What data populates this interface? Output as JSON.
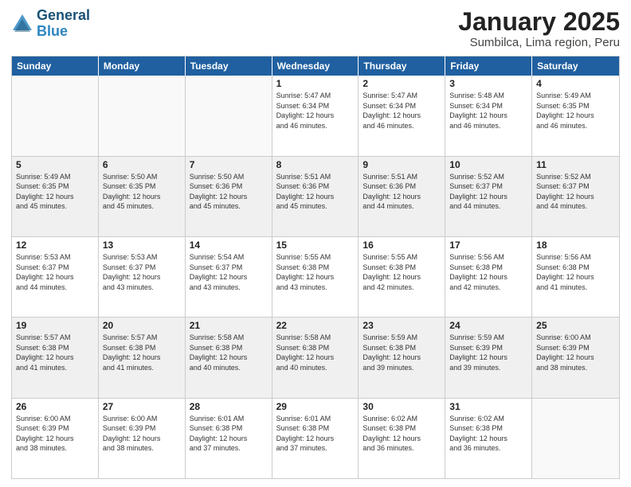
{
  "logo": {
    "text1": "General",
    "text2": "Blue"
  },
  "title": "January 2025",
  "subtitle": "Sumbilca, Lima region, Peru",
  "days": [
    "Sunday",
    "Monday",
    "Tuesday",
    "Wednesday",
    "Thursday",
    "Friday",
    "Saturday"
  ],
  "rows": [
    [
      {
        "day": "",
        "info": ""
      },
      {
        "day": "",
        "info": ""
      },
      {
        "day": "",
        "info": ""
      },
      {
        "day": "1",
        "info": "Sunrise: 5:47 AM\nSunset: 6:34 PM\nDaylight: 12 hours\nand 46 minutes."
      },
      {
        "day": "2",
        "info": "Sunrise: 5:47 AM\nSunset: 6:34 PM\nDaylight: 12 hours\nand 46 minutes."
      },
      {
        "day": "3",
        "info": "Sunrise: 5:48 AM\nSunset: 6:34 PM\nDaylight: 12 hours\nand 46 minutes."
      },
      {
        "day": "4",
        "info": "Sunrise: 5:49 AM\nSunset: 6:35 PM\nDaylight: 12 hours\nand 46 minutes."
      }
    ],
    [
      {
        "day": "5",
        "info": "Sunrise: 5:49 AM\nSunset: 6:35 PM\nDaylight: 12 hours\nand 45 minutes."
      },
      {
        "day": "6",
        "info": "Sunrise: 5:50 AM\nSunset: 6:35 PM\nDaylight: 12 hours\nand 45 minutes."
      },
      {
        "day": "7",
        "info": "Sunrise: 5:50 AM\nSunset: 6:36 PM\nDaylight: 12 hours\nand 45 minutes."
      },
      {
        "day": "8",
        "info": "Sunrise: 5:51 AM\nSunset: 6:36 PM\nDaylight: 12 hours\nand 45 minutes."
      },
      {
        "day": "9",
        "info": "Sunrise: 5:51 AM\nSunset: 6:36 PM\nDaylight: 12 hours\nand 44 minutes."
      },
      {
        "day": "10",
        "info": "Sunrise: 5:52 AM\nSunset: 6:37 PM\nDaylight: 12 hours\nand 44 minutes."
      },
      {
        "day": "11",
        "info": "Sunrise: 5:52 AM\nSunset: 6:37 PM\nDaylight: 12 hours\nand 44 minutes."
      }
    ],
    [
      {
        "day": "12",
        "info": "Sunrise: 5:53 AM\nSunset: 6:37 PM\nDaylight: 12 hours\nand 44 minutes."
      },
      {
        "day": "13",
        "info": "Sunrise: 5:53 AM\nSunset: 6:37 PM\nDaylight: 12 hours\nand 43 minutes."
      },
      {
        "day": "14",
        "info": "Sunrise: 5:54 AM\nSunset: 6:37 PM\nDaylight: 12 hours\nand 43 minutes."
      },
      {
        "day": "15",
        "info": "Sunrise: 5:55 AM\nSunset: 6:38 PM\nDaylight: 12 hours\nand 43 minutes."
      },
      {
        "day": "16",
        "info": "Sunrise: 5:55 AM\nSunset: 6:38 PM\nDaylight: 12 hours\nand 42 minutes."
      },
      {
        "day": "17",
        "info": "Sunrise: 5:56 AM\nSunset: 6:38 PM\nDaylight: 12 hours\nand 42 minutes."
      },
      {
        "day": "18",
        "info": "Sunrise: 5:56 AM\nSunset: 6:38 PM\nDaylight: 12 hours\nand 41 minutes."
      }
    ],
    [
      {
        "day": "19",
        "info": "Sunrise: 5:57 AM\nSunset: 6:38 PM\nDaylight: 12 hours\nand 41 minutes."
      },
      {
        "day": "20",
        "info": "Sunrise: 5:57 AM\nSunset: 6:38 PM\nDaylight: 12 hours\nand 41 minutes."
      },
      {
        "day": "21",
        "info": "Sunrise: 5:58 AM\nSunset: 6:38 PM\nDaylight: 12 hours\nand 40 minutes."
      },
      {
        "day": "22",
        "info": "Sunrise: 5:58 AM\nSunset: 6:38 PM\nDaylight: 12 hours\nand 40 minutes."
      },
      {
        "day": "23",
        "info": "Sunrise: 5:59 AM\nSunset: 6:38 PM\nDaylight: 12 hours\nand 39 minutes."
      },
      {
        "day": "24",
        "info": "Sunrise: 5:59 AM\nSunset: 6:39 PM\nDaylight: 12 hours\nand 39 minutes."
      },
      {
        "day": "25",
        "info": "Sunrise: 6:00 AM\nSunset: 6:39 PM\nDaylight: 12 hours\nand 38 minutes."
      }
    ],
    [
      {
        "day": "26",
        "info": "Sunrise: 6:00 AM\nSunset: 6:39 PM\nDaylight: 12 hours\nand 38 minutes."
      },
      {
        "day": "27",
        "info": "Sunrise: 6:00 AM\nSunset: 6:39 PM\nDaylight: 12 hours\nand 38 minutes."
      },
      {
        "day": "28",
        "info": "Sunrise: 6:01 AM\nSunset: 6:38 PM\nDaylight: 12 hours\nand 37 minutes."
      },
      {
        "day": "29",
        "info": "Sunrise: 6:01 AM\nSunset: 6:38 PM\nDaylight: 12 hours\nand 37 minutes."
      },
      {
        "day": "30",
        "info": "Sunrise: 6:02 AM\nSunset: 6:38 PM\nDaylight: 12 hours\nand 36 minutes."
      },
      {
        "day": "31",
        "info": "Sunrise: 6:02 AM\nSunset: 6:38 PM\nDaylight: 12 hours\nand 36 minutes."
      },
      {
        "day": "",
        "info": ""
      }
    ]
  ]
}
